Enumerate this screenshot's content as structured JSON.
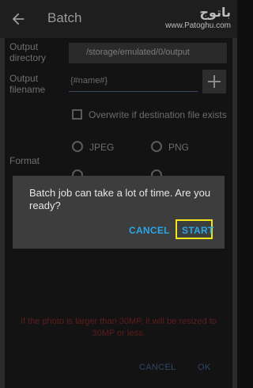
{
  "app_bar": {
    "title": "Batch",
    "back_icon": "arrow-left-icon"
  },
  "watermark": {
    "logo": "باتوج",
    "url": "www.Patoghu.com"
  },
  "form": {
    "output_directory": {
      "label": "Output directory",
      "value": "/storage/emulated/0/output"
    },
    "output_filename": {
      "label": "Output filename",
      "value": "{#name#}",
      "add_icon": "plus-icon"
    },
    "overwrite": {
      "label": "Overwrite if destination file exists",
      "checked": false
    },
    "format": {
      "label": "Format",
      "options": [
        "JPEG",
        "PNG"
      ]
    }
  },
  "info_text": "If the photo is larger than 30MP, it will be resized to 30MP or less.",
  "footer": {
    "cancel": "CANCEL",
    "ok": "OK"
  },
  "dialog": {
    "message": "Batch job can take a lot of time. Are you ready?",
    "cancel": "CANCEL",
    "start": "START",
    "accent_color": "#2aa7e6",
    "highlight_color": "#f1e51e"
  }
}
